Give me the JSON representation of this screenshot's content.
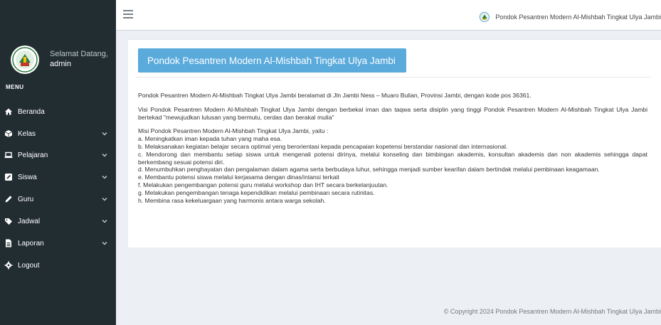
{
  "topbar": {
    "site_name": "Pondok Pesantren Modern Al-Mishbah Tingkat Ulya Jambi"
  },
  "user": {
    "greeting": "Selamat Datang,",
    "name": "admin"
  },
  "menu": {
    "header": "MENU",
    "items": [
      {
        "label": "Beranda",
        "icon": "home-icon",
        "has_children": false
      },
      {
        "label": "Kelas",
        "icon": "cube-icon",
        "has_children": true
      },
      {
        "label": "Pelajaran",
        "icon": "laptop-icon",
        "has_children": true
      },
      {
        "label": "Siswa",
        "icon": "edit-icon",
        "has_children": true
      },
      {
        "label": "Guru",
        "icon": "pencil-icon",
        "has_children": true
      },
      {
        "label": "Jadwal",
        "icon": "tag-icon",
        "has_children": true
      },
      {
        "label": "Laporan",
        "icon": "file-icon",
        "has_children": true
      },
      {
        "label": "Logout",
        "icon": "gear-icon",
        "has_children": false
      }
    ]
  },
  "main": {
    "title": "Pondok Pesantren Modern Al-Mishbah Tingkat Ulya Jambi",
    "intro": "Pondok Pesantren Modern Al-Mishbah Tingkat Ulya Jambi beralamat di Jln Jambi Ness – Muaro Bulian, Provinsi Jambi, dengan kode pos 36361.",
    "visi": "Visi Pondok Pesantren Modern Al-Mishbah Tingkat Ulya Jambi dengan berbekal iman dan taqwa serta disiplin yang tinggi Pondok Pesantren Modern Al-Mishbah Tingkat Ulya Jambi bertekad \"mewujudkan lulusan yang bermutu, cerdas dan berakal mulia\"",
    "misi_intro": "Misi Pondok Pesantren Modern Al-Mishbah Tingkat Ulya Jambi, yaitu :",
    "misi": [
      "a. Meningkatkan iman kepada tuhan yang maha esa.",
      "b. Melaksanakan kegiatan belajar secara optimal yeng berorientasi kepada pencapaian kopetensi berstandar nasional dan internasional.",
      "c. Mendorong dan membantu setiap siswa untuk mengenali potensi dirinya, melalui konseling dan bimbingan akademis, konsultan akademis dan non akademis sehingga dapat berkembang sesuai potensi diri.",
      "d. Menumbuhkan penghayatan dan pengalaman dalam agama serta berbudaya luhur, sehingga menjadi sumber kearifan dalam bertindak melalui pembinaan keagamaan.",
      "e. Membantu potensi siswa melalui kerjasama dengan dinas/intansi terkait",
      "f. Melakukan pengembangan potensi guru melalui workshop dan IHT secara berkelanjuutan.",
      "g. Melakukan pengembangan tenaga kependidikan melalui pembinaan secara rutinitas.",
      "h. Membina rasa kekeluargaan yang harmonis antara warga sekolah."
    ]
  },
  "footer": {
    "copyright": "© Copyright 2024 Pondok Pesantren Modern Al-Mishbah Tingkat Ulya Jambi"
  },
  "colors": {
    "sidebar_bg": "#222d32",
    "accent_blue": "#5aaadc",
    "page_bg": "#ecf0f5"
  }
}
